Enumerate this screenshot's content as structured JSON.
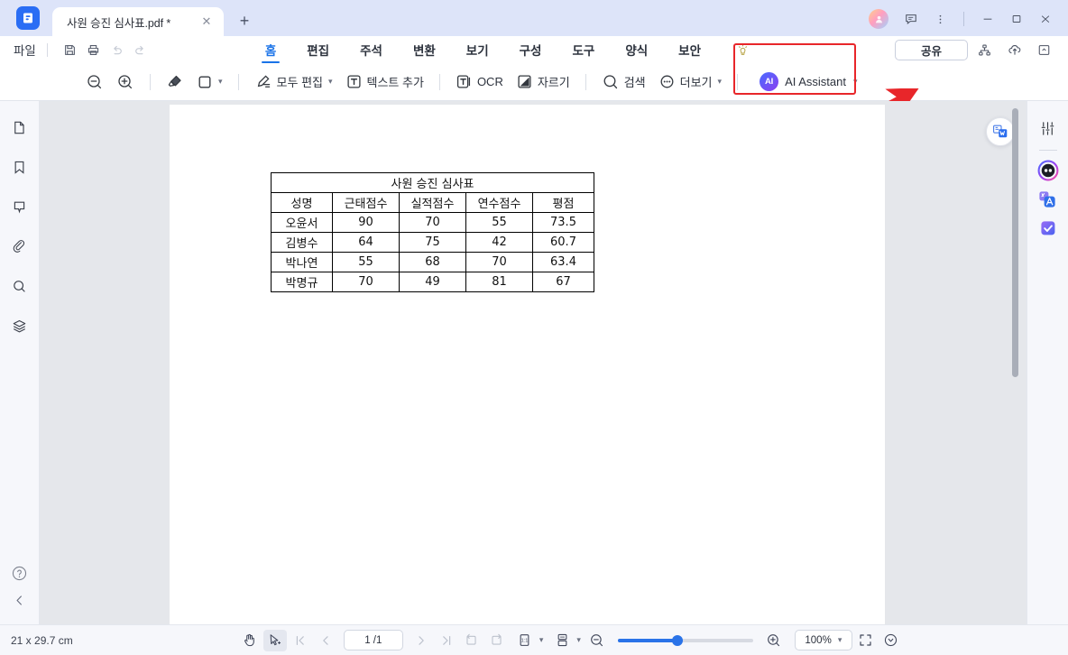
{
  "window": {
    "tab_title": "사원 승진 심사표.pdf *",
    "new_tab_label": "+",
    "close_label": "✕",
    "minimize_label": "—",
    "maximize_label": "□",
    "window_close_label": "✕"
  },
  "menubar": {
    "file_label": "파일",
    "tabs": [
      {
        "label": "홈",
        "active": true
      },
      {
        "label": "편집",
        "active": false
      },
      {
        "label": "주석",
        "active": false
      },
      {
        "label": "변환",
        "active": false
      },
      {
        "label": "보기",
        "active": false
      },
      {
        "label": "구성",
        "active": false
      },
      {
        "label": "도구",
        "active": false
      },
      {
        "label": "양식",
        "active": false
      },
      {
        "label": "보안",
        "active": false
      }
    ],
    "share_label": "공유"
  },
  "toolbar": {
    "zoom_out": "zoom-out",
    "zoom_in": "zoom-in",
    "highlight": "highlighter",
    "shape": "shape",
    "edit_all_label": "모두 편집",
    "add_text_label": "텍스트 추가",
    "ocr_label": "OCR",
    "crop_label": "자르기",
    "search_label": "검색",
    "more_label": "더보기",
    "ai_badge": "AI",
    "ai_label": "AI Assistant"
  },
  "document": {
    "table": {
      "title": "사원 승진 심사표",
      "headers": [
        "성명",
        "근태점수",
        "실적점수",
        "연수점수",
        "평점"
      ],
      "rows": [
        [
          "오윤서",
          "90",
          "70",
          "55",
          "73.5"
        ],
        [
          "김병수",
          "64",
          "75",
          "42",
          "60.7"
        ],
        [
          "박나연",
          "55",
          "68",
          "70",
          "63.4"
        ],
        [
          "박명규",
          "70",
          "49",
          "81",
          "67"
        ]
      ]
    }
  },
  "statusbar": {
    "page_size": "21 x 29.7 cm",
    "page_indicator": "1 /1",
    "zoom_level": "100%"
  },
  "colors": {
    "accent": "#2a73e8",
    "titlebar": "#dde4f9",
    "highlight_red": "#e8262a",
    "viewer_bg": "#e5e7eb",
    "rail_bg": "#f6f7fb"
  }
}
